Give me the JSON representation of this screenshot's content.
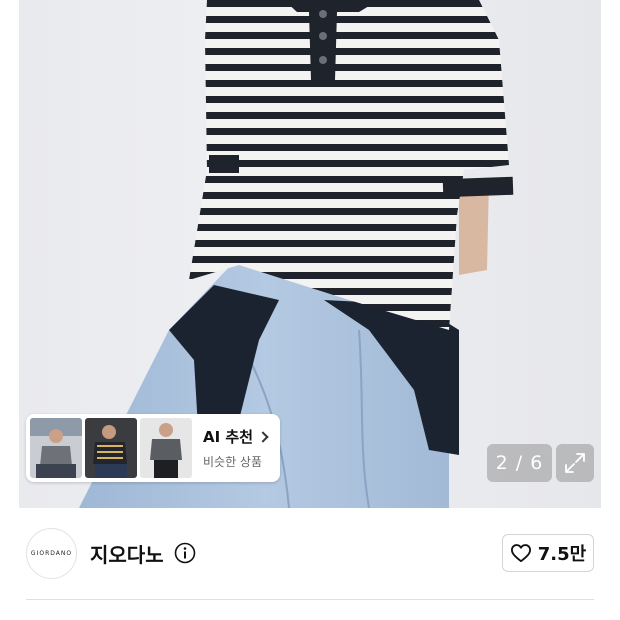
{
  "gallery": {
    "current": 2,
    "total": 6,
    "counter_text": "2 / 6",
    "expand_icon": "expand-icon",
    "colors": {
      "background": "#e9eaee",
      "jeans": "#a9c0dc",
      "stripe_dark": "#1f232c",
      "stripe_light": "#f3f3f1"
    }
  },
  "ai_recommend": {
    "title": "AI 추천",
    "subtitle": "비슷한 상품",
    "chevron_icon": "chevron-right-icon",
    "thumbnails": [
      "thumbnail-1",
      "thumbnail-2",
      "thumbnail-3"
    ]
  },
  "brand": {
    "logo_text": "GIORDANO",
    "name": "지오다노",
    "info_icon": "info-icon"
  },
  "like": {
    "icon": "heart-icon",
    "count": "7.5만"
  }
}
